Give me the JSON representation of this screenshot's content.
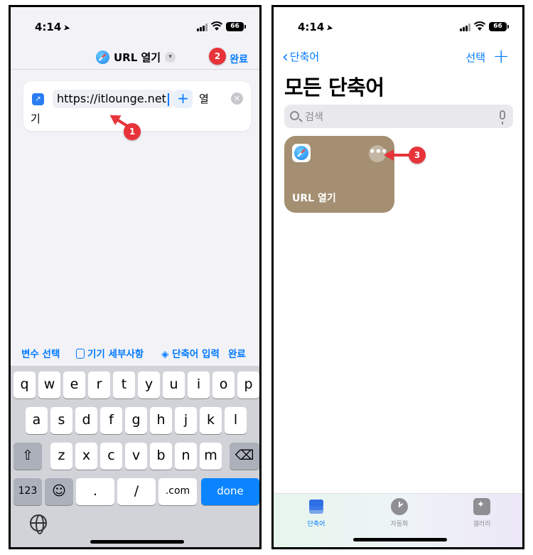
{
  "colors": {
    "accent": "#007aff",
    "annotation": "#e8333a",
    "tile": "#a48f72"
  },
  "left": {
    "status": {
      "time": "4:14",
      "battery": "66"
    },
    "nav": {
      "title": "URL 열기",
      "done": "완료"
    },
    "action": {
      "url": "https://itlounge.net",
      "plus": "+",
      "verb_part1": "열",
      "verb_part2": "기"
    },
    "suggestions": {
      "variable": "변수 선택",
      "device": "기기 세부사항",
      "input": "단축어 입력",
      "done": "완료"
    },
    "keyboard": {
      "row1": [
        "q",
        "w",
        "e",
        "r",
        "t",
        "y",
        "u",
        "i",
        "o",
        "p"
      ],
      "row2": [
        "a",
        "s",
        "d",
        "f",
        "g",
        "h",
        "j",
        "k",
        "l"
      ],
      "row3": [
        "z",
        "x",
        "c",
        "v",
        "b",
        "n",
        "m"
      ],
      "numbers": "123",
      "dot": ".",
      "slash": "/",
      "dotcom": ".com",
      "done": "done"
    }
  },
  "right": {
    "status": {
      "time": "4:14",
      "battery": "66"
    },
    "nav": {
      "back": "단축어",
      "select": "선택",
      "add": "+"
    },
    "title": "모든 단축어",
    "search_placeholder": "검색",
    "tile": {
      "label": "URL 열기",
      "more": "•••"
    },
    "tabs": [
      {
        "label": "단축어"
      },
      {
        "label": "자동화"
      },
      {
        "label": "갤러리"
      }
    ]
  },
  "annotations": {
    "one": "1",
    "two": "2",
    "three": "3"
  }
}
